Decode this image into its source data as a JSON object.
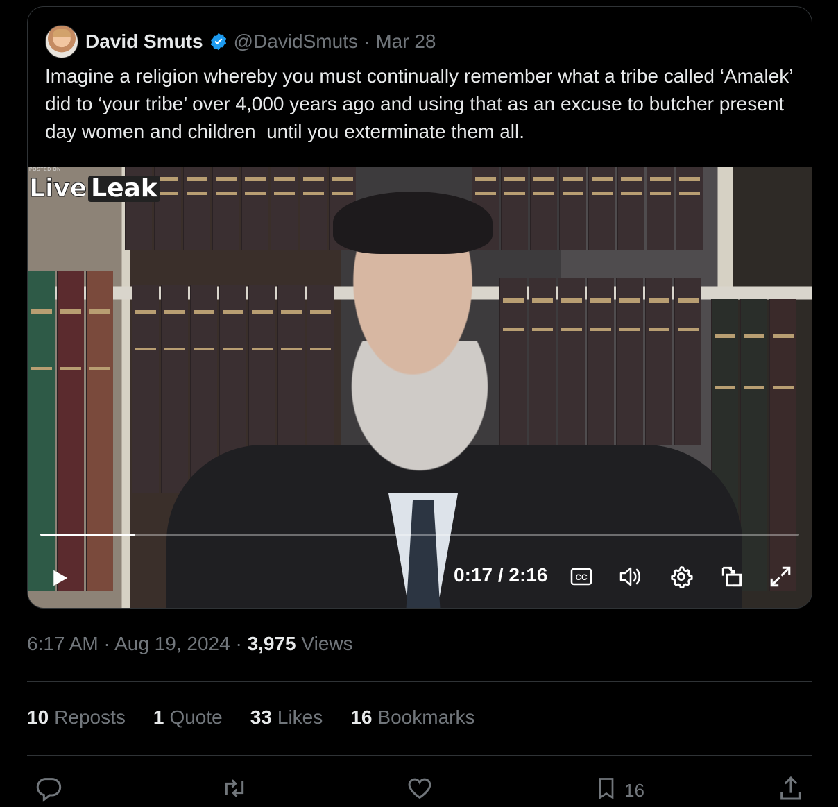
{
  "quoted_tweet": {
    "author_name": "David Smuts",
    "handle": "@DavidSmuts",
    "separator": "·",
    "date": "Mar 28",
    "text": "Imagine a religion whereby you must continually remember what a tribe called ‘Amalek’ did to ‘your tribe’ over 4,000 years ago and using that as an excuse to butcher present day women and children  until you exterminate them all."
  },
  "video": {
    "watermark_posted_on": "POSTED ON",
    "watermark_live": "Live",
    "watermark_leak": "Leak",
    "current_time": "0:17",
    "duration": "2:16",
    "time_separator": " / ",
    "progress_fraction": 0.125,
    "icons": [
      "play-icon",
      "closed-captions-icon",
      "volume-icon",
      "settings-gear-icon",
      "picture-in-picture-icon",
      "fullscreen-icon"
    ]
  },
  "tweet_meta": {
    "time": "6:17 AM",
    "date": "Aug 19, 2024",
    "separator": "·",
    "views_count": "3,975",
    "views_label": "Views"
  },
  "stats": [
    {
      "num": "10",
      "label": "Reposts"
    },
    {
      "num": "1",
      "label": "Quote"
    },
    {
      "num": "33",
      "label": "Likes"
    },
    {
      "num": "16",
      "label": "Bookmarks"
    }
  ],
  "actions": {
    "bookmark_count": "16",
    "icons": [
      "reply-icon",
      "repost-icon",
      "like-icon",
      "bookmark-icon",
      "share-icon"
    ]
  },
  "colors": {
    "background": "#000000",
    "text_primary": "#e7e9ea",
    "text_secondary": "#71767b",
    "border": "#2f3336",
    "verified": "#1d9bf0"
  }
}
